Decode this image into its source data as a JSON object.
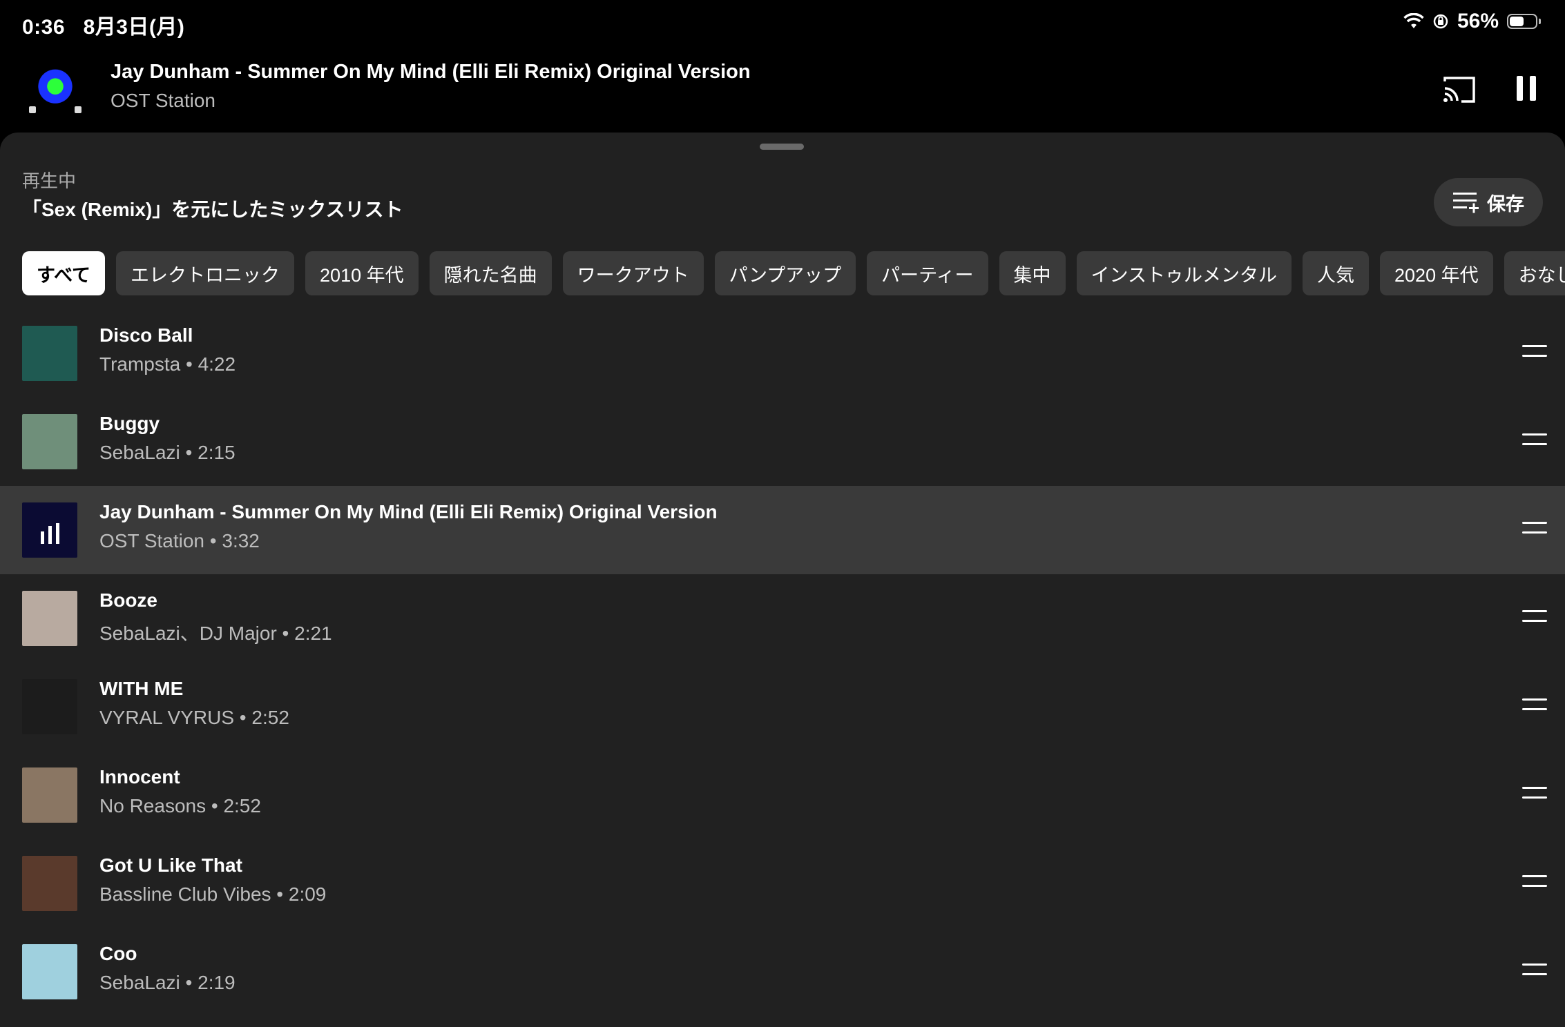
{
  "status_bar": {
    "time": "0:36",
    "date": "8月3日(月)",
    "battery_text": "56%",
    "battery_level": 0.56
  },
  "mini_player": {
    "title": "Jay Dunham - Summer On My Mind (Elli Eli Remix) Original Version",
    "artist": "OST Station",
    "icons": [
      "cast-icon",
      "pause-icon"
    ]
  },
  "queue": {
    "now_playing_label": "再生中",
    "mix_title": "「Sex (Remix)」を元にしたミックスリスト",
    "save_label": "保存"
  },
  "chips": [
    {
      "label": "すべて",
      "active": true
    },
    {
      "label": "エレクトロニック"
    },
    {
      "label": "2010 年代"
    },
    {
      "label": "隠れた名曲"
    },
    {
      "label": "ワークアウト"
    },
    {
      "label": "パンプアップ"
    },
    {
      "label": "パーティー"
    },
    {
      "label": "集中"
    },
    {
      "label": "インストゥルメンタル"
    },
    {
      "label": "人気"
    },
    {
      "label": "2020 年代"
    },
    {
      "label": "おなじみ"
    }
  ],
  "tracks": [
    {
      "title": "Disco Ball",
      "subtitle": "Trampsta • 4:22",
      "thumb_color": "#1f5a52"
    },
    {
      "title": "Buggy",
      "subtitle": "SebaLazi • 2:15",
      "thumb_color": "#6f8f7a"
    },
    {
      "title": "Jay Dunham - Summer On My Mind (Elli Eli Remix) Original Version",
      "subtitle": "OST Station • 3:32",
      "thumb_color": "#0b0b33",
      "current": true
    },
    {
      "title": "Booze",
      "subtitle": "SebaLazi、DJ Major • 2:21",
      "thumb_color": "#b8aaa0"
    },
    {
      "title": "WITH ME",
      "subtitle": "VYRAL VYRUS • 2:52",
      "thumb_color": "#1c1c1c"
    },
    {
      "title": "Innocent",
      "subtitle": "No Reasons • 2:52",
      "thumb_color": "#8a7663"
    },
    {
      "title": "Got U Like That",
      "subtitle": "Bassline Club Vibes • 2:09",
      "thumb_color": "#5a3a2c"
    },
    {
      "title": "Coo",
      "subtitle": "SebaLazi • 2:19",
      "thumb_color": "#9fd0de"
    }
  ]
}
